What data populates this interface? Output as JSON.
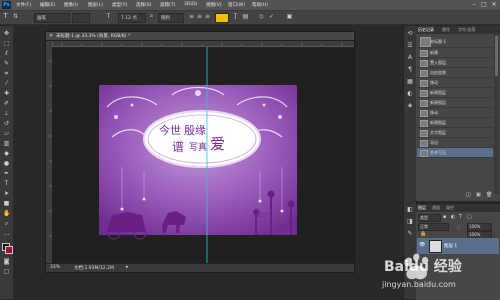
{
  "menubar": {
    "app_logo": "Ps",
    "items": [
      "文件(F)",
      "编辑(E)",
      "图像(I)",
      "图层(L)",
      "类型(Y)",
      "选择(S)",
      "滤镜(T)",
      "3D(D)",
      "视图(V)",
      "窗口(W)",
      "帮助(H)"
    ],
    "window_controls": [
      "–",
      "□",
      "✕"
    ]
  },
  "options_bar": {
    "brush_preset": "画笔",
    "font_size": "7.12 点",
    "anti_alias": "锐利"
  },
  "document": {
    "title": "未标题-1 @ 33.3% (背景, RGB/8) *",
    "status_zoom": "33%",
    "status_doc": "文档:1.93M/12.2M",
    "canvas_title_1": "今世",
    "canvas_title_2": "殷缘",
    "canvas_title_3": "谱",
    "canvas_title_4": "写真",
    "canvas_title_5": "爱",
    "canvas_overlay_text": "设计"
  },
  "history_panel": {
    "tabs": [
      "历史记录",
      "属性",
      "字符 段落"
    ],
    "snapshot": "未标题-1",
    "items": [
      "新建",
      "置入图层",
      "自由变换",
      "移动",
      "新建图层",
      "新建图层",
      "移动",
      "新建图层",
      "文字图层",
      "导出",
      "合并可见"
    ],
    "selected_index": 10
  },
  "layers_panel": {
    "tabs": [
      "图层",
      "通道",
      "路径"
    ],
    "kind_filter": "类型",
    "blend_mode": "正常",
    "opacity": "100%",
    "fill": "100%",
    "layer_name": "图层 1"
  },
  "watermark": {
    "brand": "Baidu 经验",
    "url": "jingyan.baidu.com"
  },
  "colors": {
    "accent": "#5a6f8b",
    "canvas_purple": "#8a4fa8",
    "guide": "#20d0d0"
  }
}
